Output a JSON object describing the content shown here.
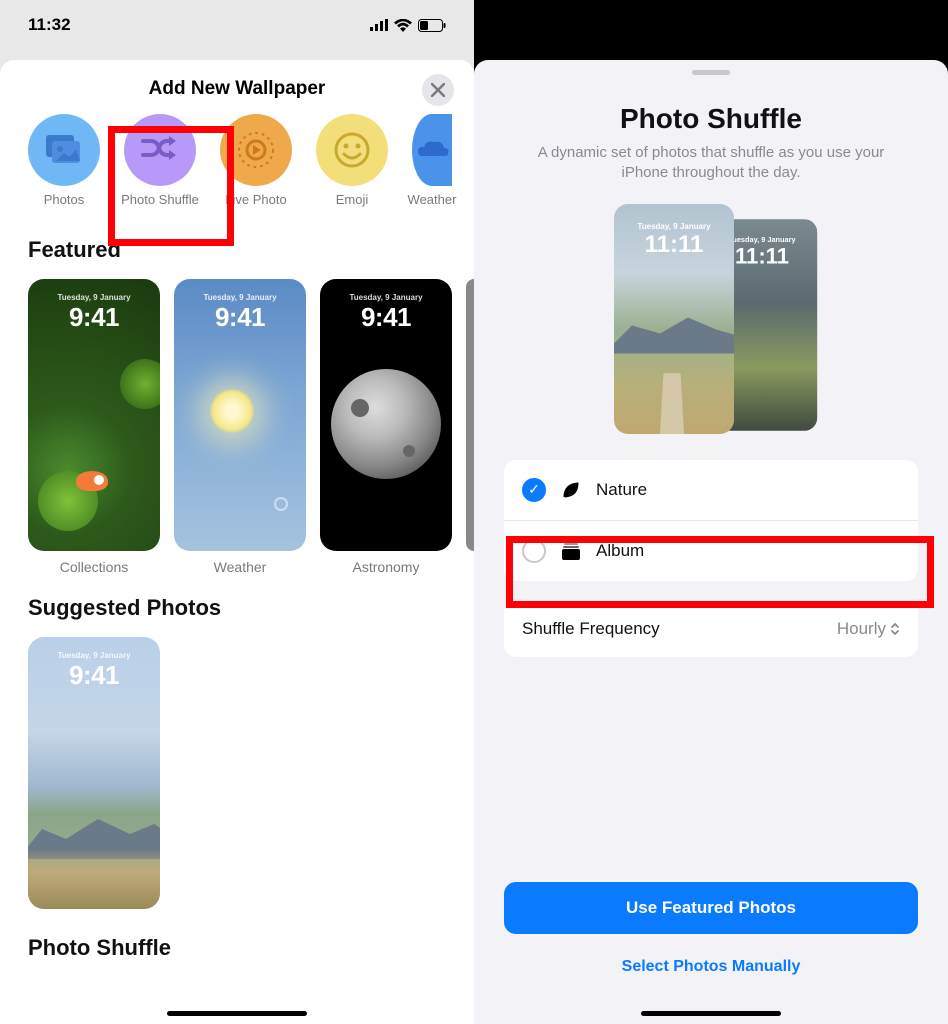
{
  "status": {
    "time": "11:32"
  },
  "left": {
    "title": "Add New Wallpaper",
    "categories": [
      {
        "label": "Photos"
      },
      {
        "label": "Photo Shuffle"
      },
      {
        "label": "Live Photo"
      },
      {
        "label": "Emoji"
      },
      {
        "label": "Weather"
      }
    ],
    "sections": {
      "featured": "Featured",
      "suggested": "Suggested Photos",
      "shuffle": "Photo Shuffle"
    },
    "featured_items": [
      {
        "label": "Collections"
      },
      {
        "label": "Weather"
      },
      {
        "label": "Astronomy"
      }
    ],
    "preview": {
      "date": "Tuesday, 9 January",
      "time": "9:41"
    }
  },
  "right": {
    "title": "Photo Shuffle",
    "subtitle": "A dynamic set of photos that shuffle as you use your iPhone throughout the day.",
    "preview": {
      "date": "Tuesday, 9 January",
      "time": "11:11"
    },
    "options": [
      {
        "label": "Nature",
        "checked": true
      },
      {
        "label": "Album",
        "checked": false
      }
    ],
    "frequency": {
      "label": "Shuffle Frequency",
      "value": "Hourly"
    },
    "primary_btn": "Use Featured Photos",
    "secondary_btn": "Select Photos Manually"
  }
}
